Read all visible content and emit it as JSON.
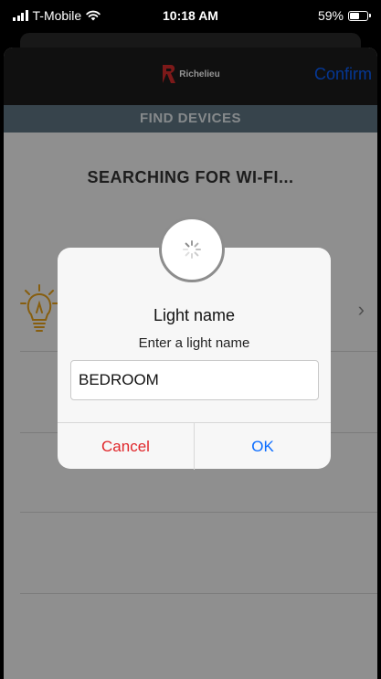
{
  "status_bar": {
    "carrier": "T-Mobile",
    "time": "10:18 AM",
    "battery_percent": "59%",
    "icons": [
      "signal-icon",
      "wifi-icon",
      "battery-icon"
    ]
  },
  "navbar": {
    "logo_text": "Richelieu",
    "confirm_label": "Confirm"
  },
  "section": {
    "title": "FIND DEVICES"
  },
  "content": {
    "searching_text": "SEARCHING FOR WI-FI...",
    "device_icon": "light-bulb-icon"
  },
  "dialog": {
    "title": "Light name",
    "message": "Enter a light name",
    "input_value": "BEDROOM",
    "cancel_label": "Cancel",
    "ok_label": "OK"
  },
  "colors": {
    "accent_blue": "#0a60ff",
    "cancel_red": "#e0262a",
    "section_bar": "#5f7584",
    "navbar": "#1c1c1c",
    "bulb": "#e8a21a"
  }
}
